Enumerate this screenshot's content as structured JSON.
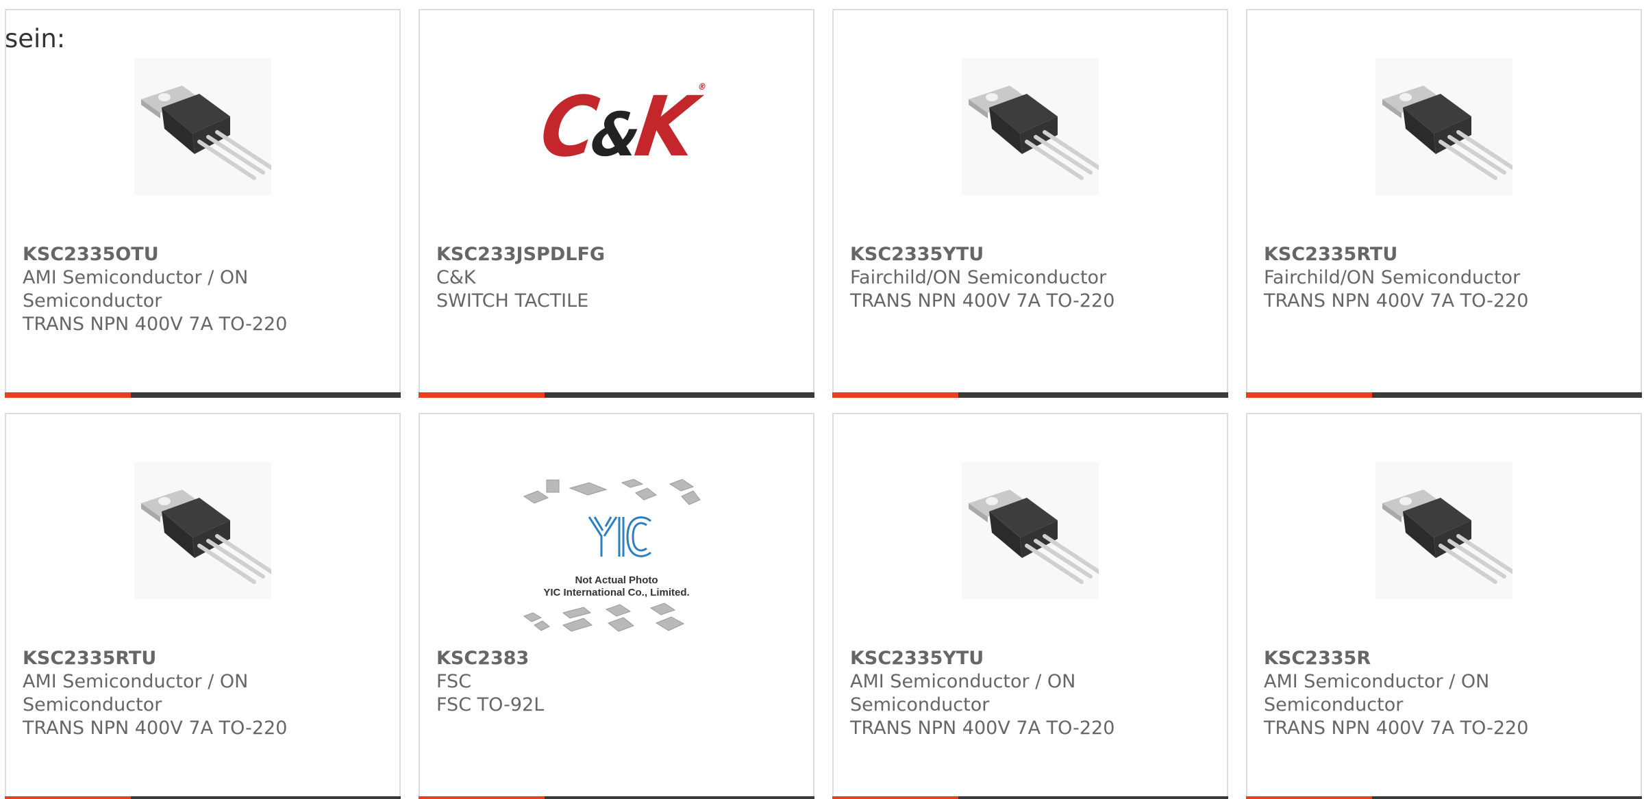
{
  "intro_text": "sein:",
  "colors": {
    "accent": "#e8401c",
    "bar": "#3a3a3a",
    "text": "#666666",
    "card_border": "#dcdcdc",
    "ck_logo_red": "#c3272c",
    "yic_logo_blue": "#2a7fc0"
  },
  "cards": [
    {
      "part": "KSC2335OTU",
      "manufacturer": "AMI Semiconductor / ON Semiconductor",
      "description": "TRANS NPN 400V 7A TO-220",
      "image": "to220-transistor-image"
    },
    {
      "part": "KSC233JSPDLFG",
      "manufacturer": "C&K",
      "description": "SWITCH TACTILE",
      "image": "ck-logo-image",
      "logo": {
        "left": "C",
        "amp": "&",
        "right": "K",
        "reg": "®"
      }
    },
    {
      "part": "KSC2335YTU",
      "manufacturer": "Fairchild/ON Semiconductor",
      "description": "TRANS NPN 400V 7A TO-220",
      "image": "to220-transistor-image"
    },
    {
      "part": "KSC2335RTU",
      "manufacturer": "Fairchild/ON Semiconductor",
      "description": "TRANS NPN 400V 7A TO-220",
      "image": "to220-transistor-image"
    },
    {
      "part": "KSC2335RTU",
      "manufacturer": "AMI Semiconductor / ON Semiconductor",
      "description": "TRANS NPN 400V 7A TO-220",
      "image": "to220-transistor-image"
    },
    {
      "part": "KSC2383",
      "manufacturer": "FSC",
      "description": "FSC TO-92L",
      "image": "yic-not-actual-photo-image",
      "placeholder": {
        "logo": "YIC",
        "line1": "Not Actual Photo",
        "line2": "YIC International Co., Limited."
      }
    },
    {
      "part": "KSC2335YTU",
      "manufacturer": "AMI Semiconductor / ON Semiconductor",
      "description": "TRANS NPN 400V 7A TO-220",
      "image": "to220-transistor-image"
    },
    {
      "part": "KSC2335R",
      "manufacturer": "AMI Semiconductor / ON Semiconductor",
      "description": "TRANS NPN 400V 7A TO-220",
      "image": "to220-transistor-image"
    }
  ]
}
